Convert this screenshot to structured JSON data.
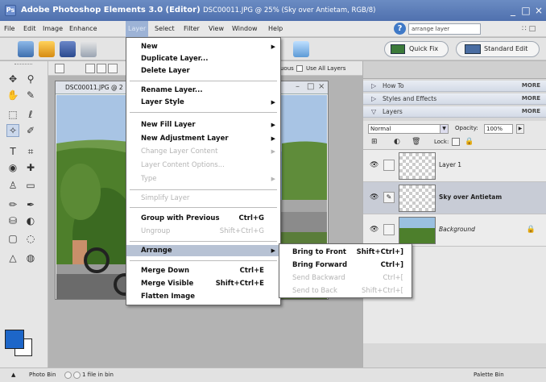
{
  "window": {
    "title": "Adobe Photoshop Elements 3.0 (Editor)",
    "doc_info": "DSC00011.JPG @ 25% (Sky over Antietam, RGB/8)",
    "min": "_",
    "restore": "□",
    "close": "×"
  },
  "menubar": {
    "items": [
      "File",
      "Edit",
      "Image",
      "Enhance",
      "Layer",
      "Select",
      "Filter",
      "View",
      "Window",
      "Help"
    ],
    "search_value": "arrange layer",
    "right_controls": "∷  □"
  },
  "shortcuts": {
    "quick_fix": "Quick Fix",
    "standard_edit": "Standard Edit"
  },
  "options_bar": {
    "contiguous_partial": "uous",
    "use_all_layers": "Use All Layers"
  },
  "document": {
    "tab_title": "DSC00011.JPG @ 2",
    "minimize": "–",
    "maximize": "□",
    "close": "×"
  },
  "layer_menu": {
    "items": [
      {
        "label": "New",
        "submenu": true,
        "enabled": true
      },
      {
        "label": "Duplicate Layer...",
        "enabled": true
      },
      {
        "label": "Delete Layer",
        "enabled": true
      },
      {
        "label": "Rename Layer...",
        "enabled": true
      },
      {
        "label": "Layer Style",
        "submenu": true,
        "enabled": true
      },
      {
        "label": "New Fill Layer",
        "submenu": true,
        "enabled": true
      },
      {
        "label": "New Adjustment Layer",
        "submenu": true,
        "enabled": true
      },
      {
        "label": "Change Layer Content",
        "submenu": true,
        "enabled": false
      },
      {
        "label": "Layer Content Options...",
        "enabled": false
      },
      {
        "label": "Type",
        "submenu": true,
        "enabled": false
      },
      {
        "label": "Simplify Layer",
        "enabled": false
      },
      {
        "label": "Group with Previous",
        "shortcut": "Ctrl+G",
        "enabled": true
      },
      {
        "label": "Ungroup",
        "shortcut": "Shift+Ctrl+G",
        "enabled": false
      },
      {
        "label": "Arrange",
        "submenu": true,
        "enabled": true,
        "highlighted": true
      },
      {
        "label": "Merge Down",
        "shortcut": "Ctrl+E",
        "enabled": true
      },
      {
        "label": "Merge Visible",
        "shortcut": "Shift+Ctrl+E",
        "enabled": true
      },
      {
        "label": "Flatten Image",
        "enabled": true
      }
    ]
  },
  "arrange_submenu": {
    "items": [
      {
        "label": "Bring to Front",
        "shortcut": "Shift+Ctrl+]",
        "enabled": true
      },
      {
        "label": "Bring Forward",
        "shortcut": "Ctrl+]",
        "enabled": true
      },
      {
        "label": "Send Backward",
        "shortcut": "Ctrl+[",
        "enabled": false
      },
      {
        "label": "Send to Back",
        "shortcut": "Shift+Ctrl+[",
        "enabled": false
      }
    ]
  },
  "palettes": {
    "how_to": "How To",
    "styles_effects": "Styles and Effects",
    "layers": "Layers",
    "more": "MORE"
  },
  "layers_panel": {
    "blend_mode": "Normal",
    "opacity_label": "Opacity:",
    "opacity_value": "100%",
    "lock_label": "Lock:",
    "layers": [
      {
        "name": "Layer 1",
        "selected": false
      },
      {
        "name": "Sky over Antietam",
        "selected": true
      },
      {
        "name": "Background",
        "selected": false
      }
    ]
  },
  "statusbar": {
    "photo_bin": "Photo Bin",
    "files_in_bin": "1 file in bin",
    "palette_bin": "Palette Bin"
  },
  "colors": {
    "foreground": "#1d66c8",
    "background": "#ffffff",
    "menu_highlight": "#b7c2d4"
  }
}
